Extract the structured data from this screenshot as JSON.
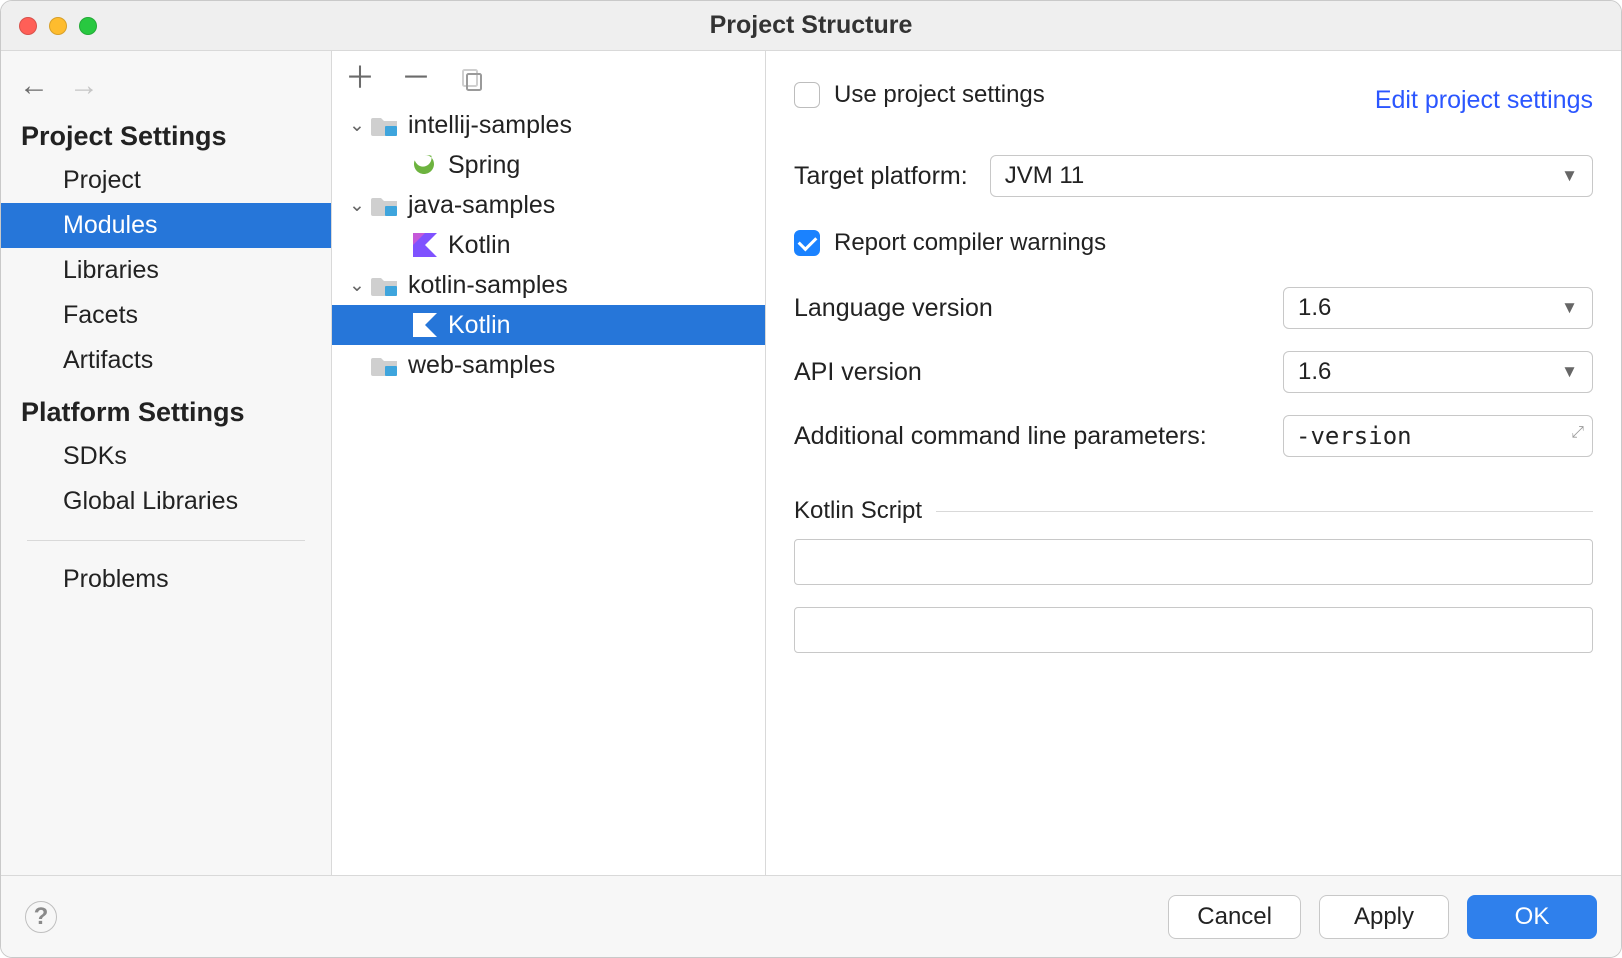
{
  "window": {
    "title": "Project Structure"
  },
  "sidebar": {
    "sections": [
      {
        "title": "Project Settings",
        "items": [
          {
            "id": "project",
            "label": "Project",
            "selected": false
          },
          {
            "id": "modules",
            "label": "Modules",
            "selected": true
          },
          {
            "id": "libraries",
            "label": "Libraries",
            "selected": false
          },
          {
            "id": "facets",
            "label": "Facets",
            "selected": false
          },
          {
            "id": "artifacts",
            "label": "Artifacts",
            "selected": false
          }
        ]
      },
      {
        "title": "Platform Settings",
        "items": [
          {
            "id": "sdks",
            "label": "SDKs",
            "selected": false
          },
          {
            "id": "global-libraries",
            "label": "Global Libraries",
            "selected": false
          }
        ]
      }
    ],
    "extra": {
      "problems_label": "Problems"
    }
  },
  "tree": {
    "nodes": [
      {
        "depth": 0,
        "expander": "v",
        "icon": "module-folder",
        "label": "intellij-samples",
        "selected": false
      },
      {
        "depth": 1,
        "expander": "",
        "icon": "spring",
        "label": "Spring",
        "selected": false
      },
      {
        "depth": 0,
        "expander": "v",
        "icon": "module-folder",
        "label": "java-samples",
        "selected": false
      },
      {
        "depth": 1,
        "expander": "",
        "icon": "kotlin",
        "label": "Kotlin",
        "selected": false
      },
      {
        "depth": 0,
        "expander": "v",
        "icon": "module-folder",
        "label": "kotlin-samples",
        "selected": false
      },
      {
        "depth": 1,
        "expander": "",
        "icon": "kotlin",
        "label": "Kotlin",
        "selected": true
      },
      {
        "depth": 0,
        "expander": "",
        "icon": "module-folder",
        "label": "web-samples",
        "selected": false
      }
    ]
  },
  "details": {
    "use_project_settings": {
      "label": "Use project settings",
      "checked": false
    },
    "edit_link": "Edit project settings",
    "target_platform": {
      "label": "Target platform:",
      "value": "JVM 11"
    },
    "report_warnings": {
      "label": "Report compiler warnings",
      "checked": true
    },
    "language_version": {
      "label": "Language version",
      "value": "1.6"
    },
    "api_version": {
      "label": "API version",
      "value": "1.6"
    },
    "additional_params": {
      "label": "Additional command line parameters:",
      "value": "-version"
    },
    "kotlin_script_header": "Kotlin Script",
    "script_field_1": "",
    "script_field_2": ""
  },
  "footer": {
    "cancel": "Cancel",
    "apply": "Apply",
    "ok": "OK"
  },
  "colors": {
    "selection": "#2676d9",
    "primary_button": "#2f80ec",
    "link": "#2b56ff"
  }
}
